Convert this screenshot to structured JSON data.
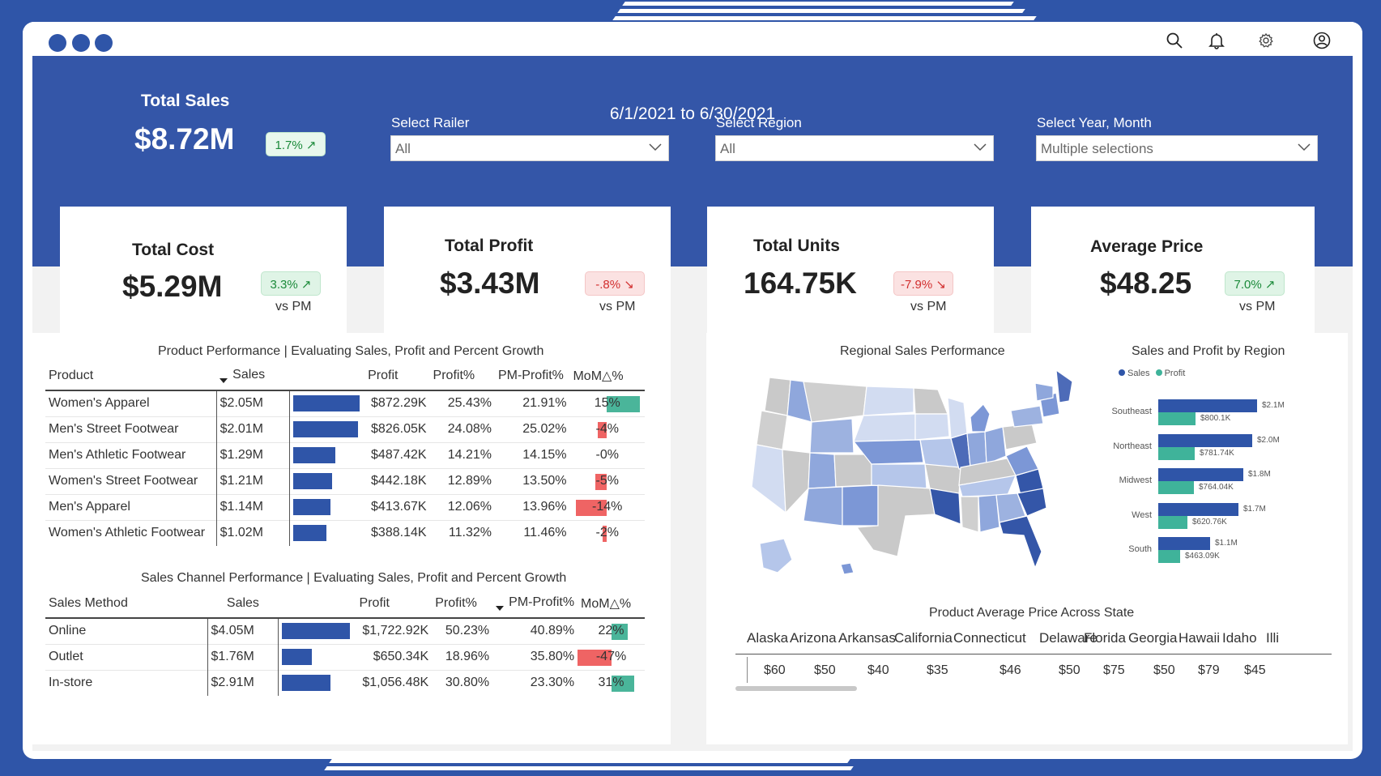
{
  "window": {
    "icons": [
      "search-icon",
      "bell-icon",
      "gear-icon",
      "user-icon"
    ]
  },
  "header": {
    "total_sales_title": "Total Sales",
    "total_sales_value": "$8.72M",
    "total_sales_change": "1.7% ↗",
    "date_range": "6/1/2021 to 6/30/2021",
    "slicers": [
      {
        "label": "Select Railer",
        "value": "All"
      },
      {
        "label": "Select Region",
        "value": "All"
      },
      {
        "label": "Select Year, Month",
        "value": "Multiple selections"
      }
    ]
  },
  "kpis": [
    {
      "title": "Total Cost",
      "value": "$5.29M",
      "change": "3.3% ↗",
      "direction": "up",
      "sub": "vs PM"
    },
    {
      "title": "Total Profit",
      "value": "$3.43M",
      "change": "-.8% ↘",
      "direction": "down",
      "sub": "vs PM"
    },
    {
      "title": "Total Units",
      "value": "164.75K",
      "change": "-7.9% ↘",
      "direction": "down",
      "sub": "vs PM"
    },
    {
      "title": "Average Price",
      "value": "$48.25",
      "change": "7.0% ↗",
      "direction": "up",
      "sub": "vs PM"
    }
  ],
  "product_table": {
    "title": "Product Performance | Evaluating Sales, Profit and Percent Growth",
    "headers": [
      "Product",
      "Sales",
      "Profit",
      "Profit%",
      "PM-Profit%",
      "MoM△%"
    ],
    "rows": [
      {
        "product": "Women's Apparel",
        "sales": "$2.05M",
        "sales_value": 2.05,
        "profit": "$872.29K",
        "profit_pct": "25.43%",
        "pm_profit_pct": "21.91%",
        "mom": "15%",
        "mom_value": 15
      },
      {
        "product": "Men's Street Footwear",
        "sales": "$2.01M",
        "sales_value": 2.01,
        "profit": "$826.05K",
        "profit_pct": "24.08%",
        "pm_profit_pct": "25.02%",
        "mom": "-4%",
        "mom_value": -4
      },
      {
        "product": "Men's Athletic Footwear",
        "sales": "$1.29M",
        "sales_value": 1.29,
        "profit": "$487.42K",
        "profit_pct": "14.21%",
        "pm_profit_pct": "14.15%",
        "mom": "-0%",
        "mom_value": 0
      },
      {
        "product": "Women's Street Footwear",
        "sales": "$1.21M",
        "sales_value": 1.21,
        "profit": "$442.18K",
        "profit_pct": "12.89%",
        "pm_profit_pct": "13.50%",
        "mom": "-5%",
        "mom_value": -5
      },
      {
        "product": "Men's Apparel",
        "sales": "$1.14M",
        "sales_value": 1.14,
        "profit": "$413.67K",
        "profit_pct": "12.06%",
        "pm_profit_pct": "13.96%",
        "mom": "-14%",
        "mom_value": -14
      },
      {
        "product": "Women's Athletic Footwear",
        "sales": "$1.02M",
        "sales_value": 1.02,
        "profit": "$388.14K",
        "profit_pct": "11.32%",
        "pm_profit_pct": "11.46%",
        "mom": "-2%",
        "mom_value": -2
      }
    ]
  },
  "channel_table": {
    "title": "Sales Channel Performance | Evaluating Sales, Profit and Percent Growth",
    "headers": [
      "Sales Method",
      "Sales",
      "Profit",
      "Profit%",
      "PM-Profit%",
      "MoM△%"
    ],
    "rows": [
      {
        "method": "Online",
        "sales": "$4.05M",
        "sales_value": 4.05,
        "profit": "$1,722.92K",
        "profit_pct": "50.23%",
        "pm_profit_pct": "40.89%",
        "mom": "22%",
        "mom_value": 22
      },
      {
        "method": "Outlet",
        "sales": "$1.76M",
        "sales_value": 1.76,
        "profit": "$650.34K",
        "profit_pct": "18.96%",
        "pm_profit_pct": "35.80%",
        "mom": "-47%",
        "mom_value": -47
      },
      {
        "method": "In-store",
        "sales": "$2.91M",
        "sales_value": 2.91,
        "profit": "$1,056.48K",
        "profit_pct": "30.80%",
        "pm_profit_pct": "23.30%",
        "mom": "31%",
        "mom_value": 31
      }
    ]
  },
  "map": {
    "title": "Regional Sales Performance"
  },
  "chart_data": {
    "type": "bar",
    "title": "Sales and Profit by Region",
    "orientation": "horizontal",
    "categories": [
      "Southeast",
      "Northeast",
      "Midwest",
      "West",
      "South"
    ],
    "series": [
      {
        "name": "Sales",
        "color": "#2f55a8",
        "values": [
          2.1,
          2.0,
          1.8,
          1.7,
          1.1
        ],
        "labels": [
          "$2.1M",
          "$2.0M",
          "$1.8M",
          "$1.7M",
          "$1.1M"
        ]
      },
      {
        "name": "Profit",
        "color": "#3fb39a",
        "values": [
          0.8001,
          0.78174,
          0.76404,
          0.62076,
          0.46309
        ],
        "labels": [
          "$800.1K",
          "$781.74K",
          "$764.04K",
          "$620.76K",
          "$463.09K"
        ]
      }
    ],
    "legend": "top-left"
  },
  "price_table": {
    "title": "Product Average Price Across State",
    "states": [
      "Alaska",
      "Arizona",
      "Arkansas",
      "California",
      "Connecticut",
      "Delaware",
      "Florida",
      "Georgia",
      "Hawaii",
      "Idaho",
      "Illi"
    ],
    "prices": [
      "$60",
      "$50",
      "$40",
      "$35",
      "$46",
      "$50",
      "$75",
      "$50",
      "$79",
      "$45"
    ]
  },
  "colors": {
    "brand": "#2f55a8",
    "positive": "#4ab59a",
    "negative": "#ef6464"
  }
}
